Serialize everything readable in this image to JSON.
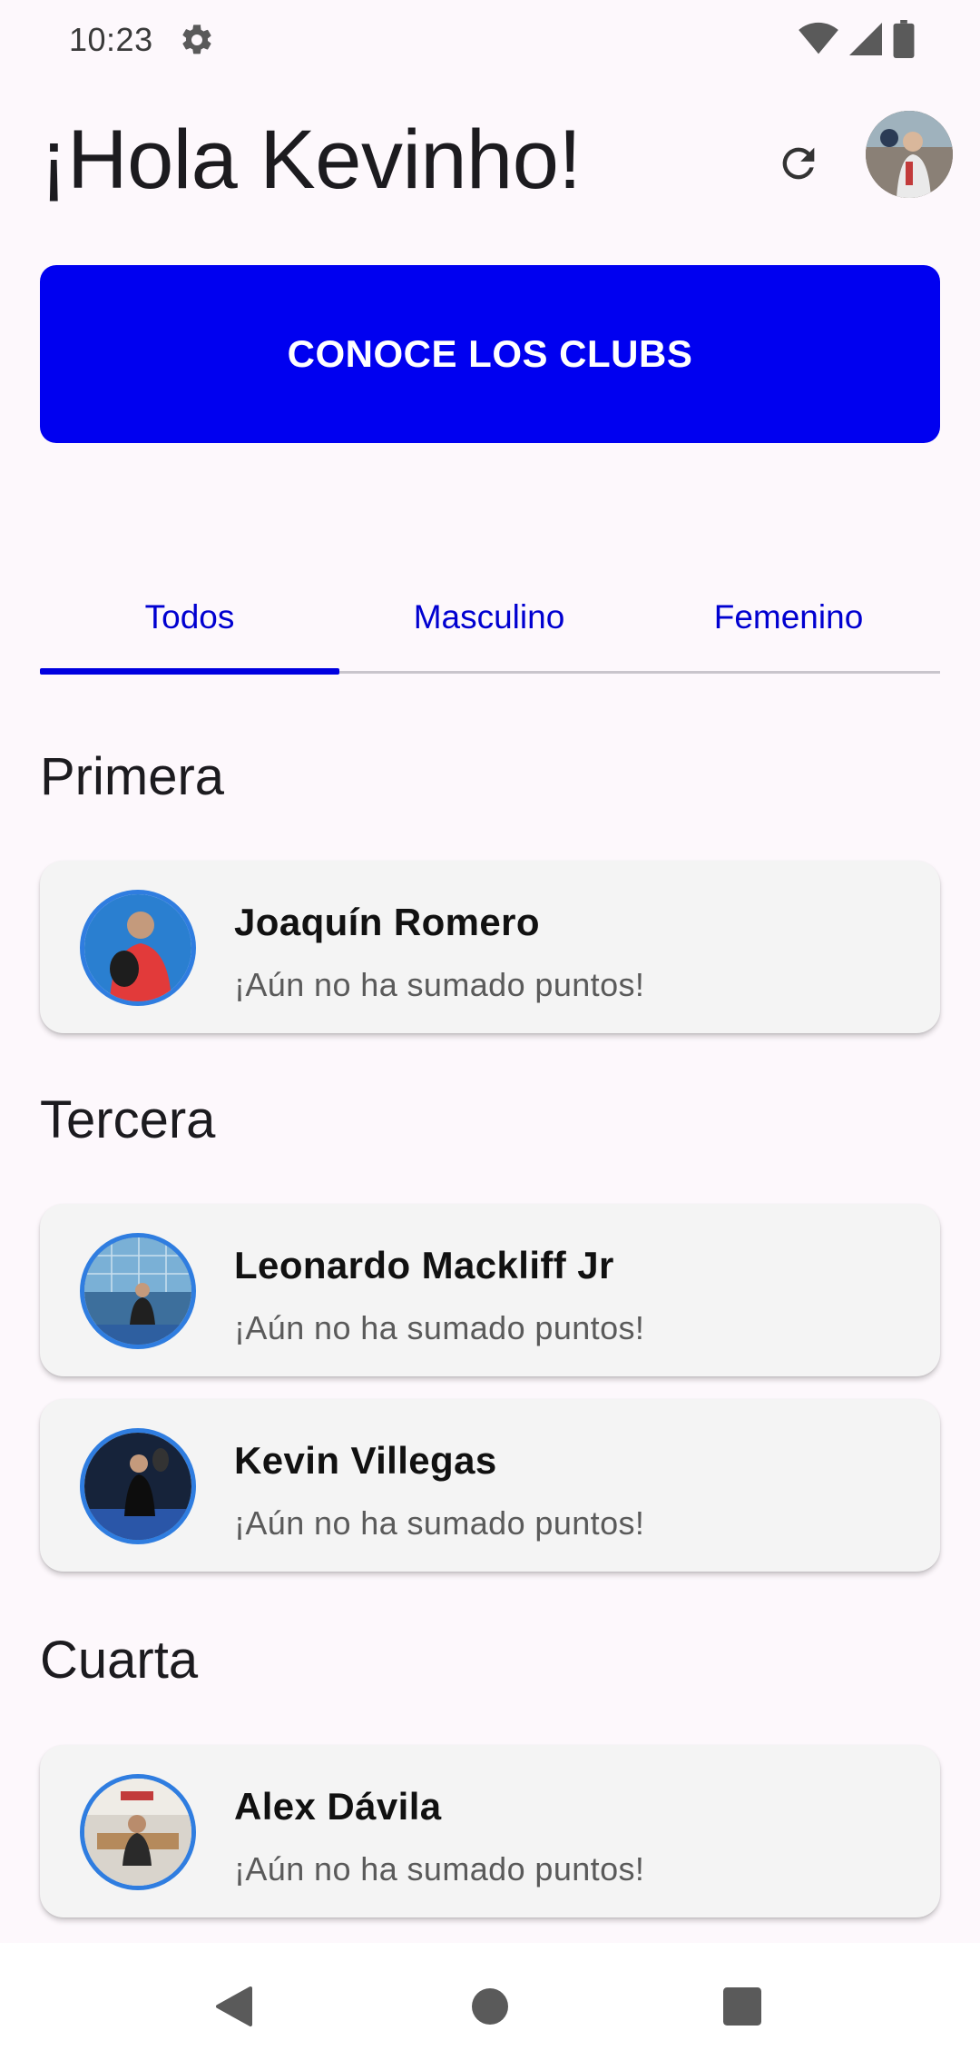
{
  "status": {
    "time": "10:23"
  },
  "header": {
    "greeting": "¡Hola Kevinho!"
  },
  "cta": {
    "label": "CONOCE LOS CLUBS",
    "color": "#0000F0"
  },
  "tabs": [
    {
      "label": "Todos",
      "selected": true
    },
    {
      "label": "Masculino",
      "selected": false
    },
    {
      "label": "Femenino",
      "selected": false
    }
  ],
  "sections": [
    {
      "title": "Primera",
      "players": [
        {
          "name": "Joaquín Romero",
          "status": "¡Aún no ha sumado puntos!"
        }
      ]
    },
    {
      "title": "Tercera",
      "players": [
        {
          "name": "Leonardo  Mackliff Jr",
          "status": "¡Aún no ha sumado puntos!"
        },
        {
          "name": "Kevin Villegas",
          "status": "¡Aún no ha sumado puntos!"
        }
      ]
    },
    {
      "title": "Cuarta",
      "players": [
        {
          "name": "Alex Dávila",
          "status": "¡Aún no ha sumado puntos!"
        }
      ]
    }
  ],
  "icons": {
    "settings": "gear-icon",
    "wifi": "wifi-icon",
    "signal": "signal-icon",
    "battery": "battery-icon",
    "refresh": "refresh-icon",
    "back": "back-icon",
    "home": "home-icon",
    "recents": "recents-icon"
  },
  "colors": {
    "accent": "#0000E0",
    "avatar_ring": "#2F7DE0",
    "background": "#FDF8FC"
  }
}
